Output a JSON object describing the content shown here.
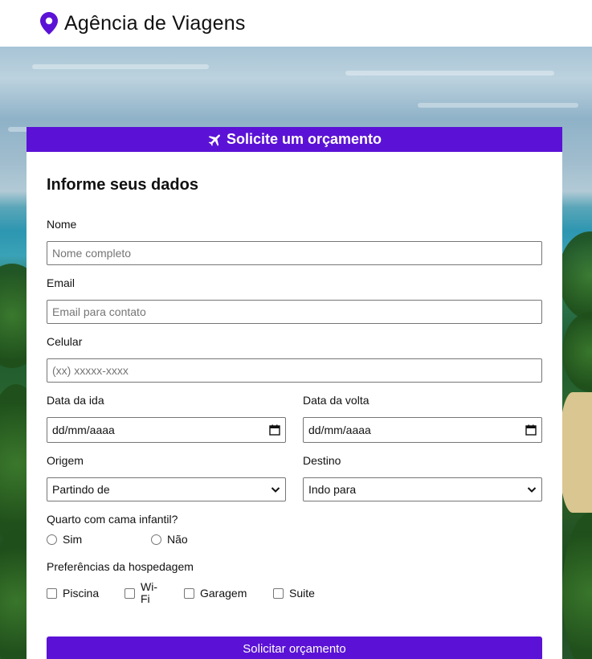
{
  "header": {
    "brand": "Agência de Viagens",
    "icon": "map-pin-icon",
    "accent": "#5b12d6"
  },
  "form": {
    "banner": "Solicite um orçamento",
    "banner_icon": "airplane-icon",
    "section_title": "Informe seus dados",
    "nome": {
      "label": "Nome",
      "placeholder": "Nome completo"
    },
    "email": {
      "label": "Email",
      "placeholder": "Email para contato"
    },
    "celular": {
      "label": "Celular",
      "placeholder": "(xx) xxxxx-xxxx"
    },
    "data_ida": {
      "label": "Data da ida",
      "value": "dd/mm/aaaa"
    },
    "data_volta": {
      "label": "Data da volta",
      "value": "dd/mm/aaaa"
    },
    "origem": {
      "label": "Origem",
      "value": "Partindo de"
    },
    "destino": {
      "label": "Destino",
      "value": "Indo para"
    },
    "cama_infantil": {
      "label": "Quarto com cama infantil?",
      "options": [
        "Sim",
        "Não"
      ]
    },
    "preferencias": {
      "label": "Preferências da hospedagem",
      "options": [
        "Piscina",
        "Wi-Fi",
        "Garagem",
        "Suite"
      ]
    },
    "submit": "Solicitar orçamento"
  }
}
